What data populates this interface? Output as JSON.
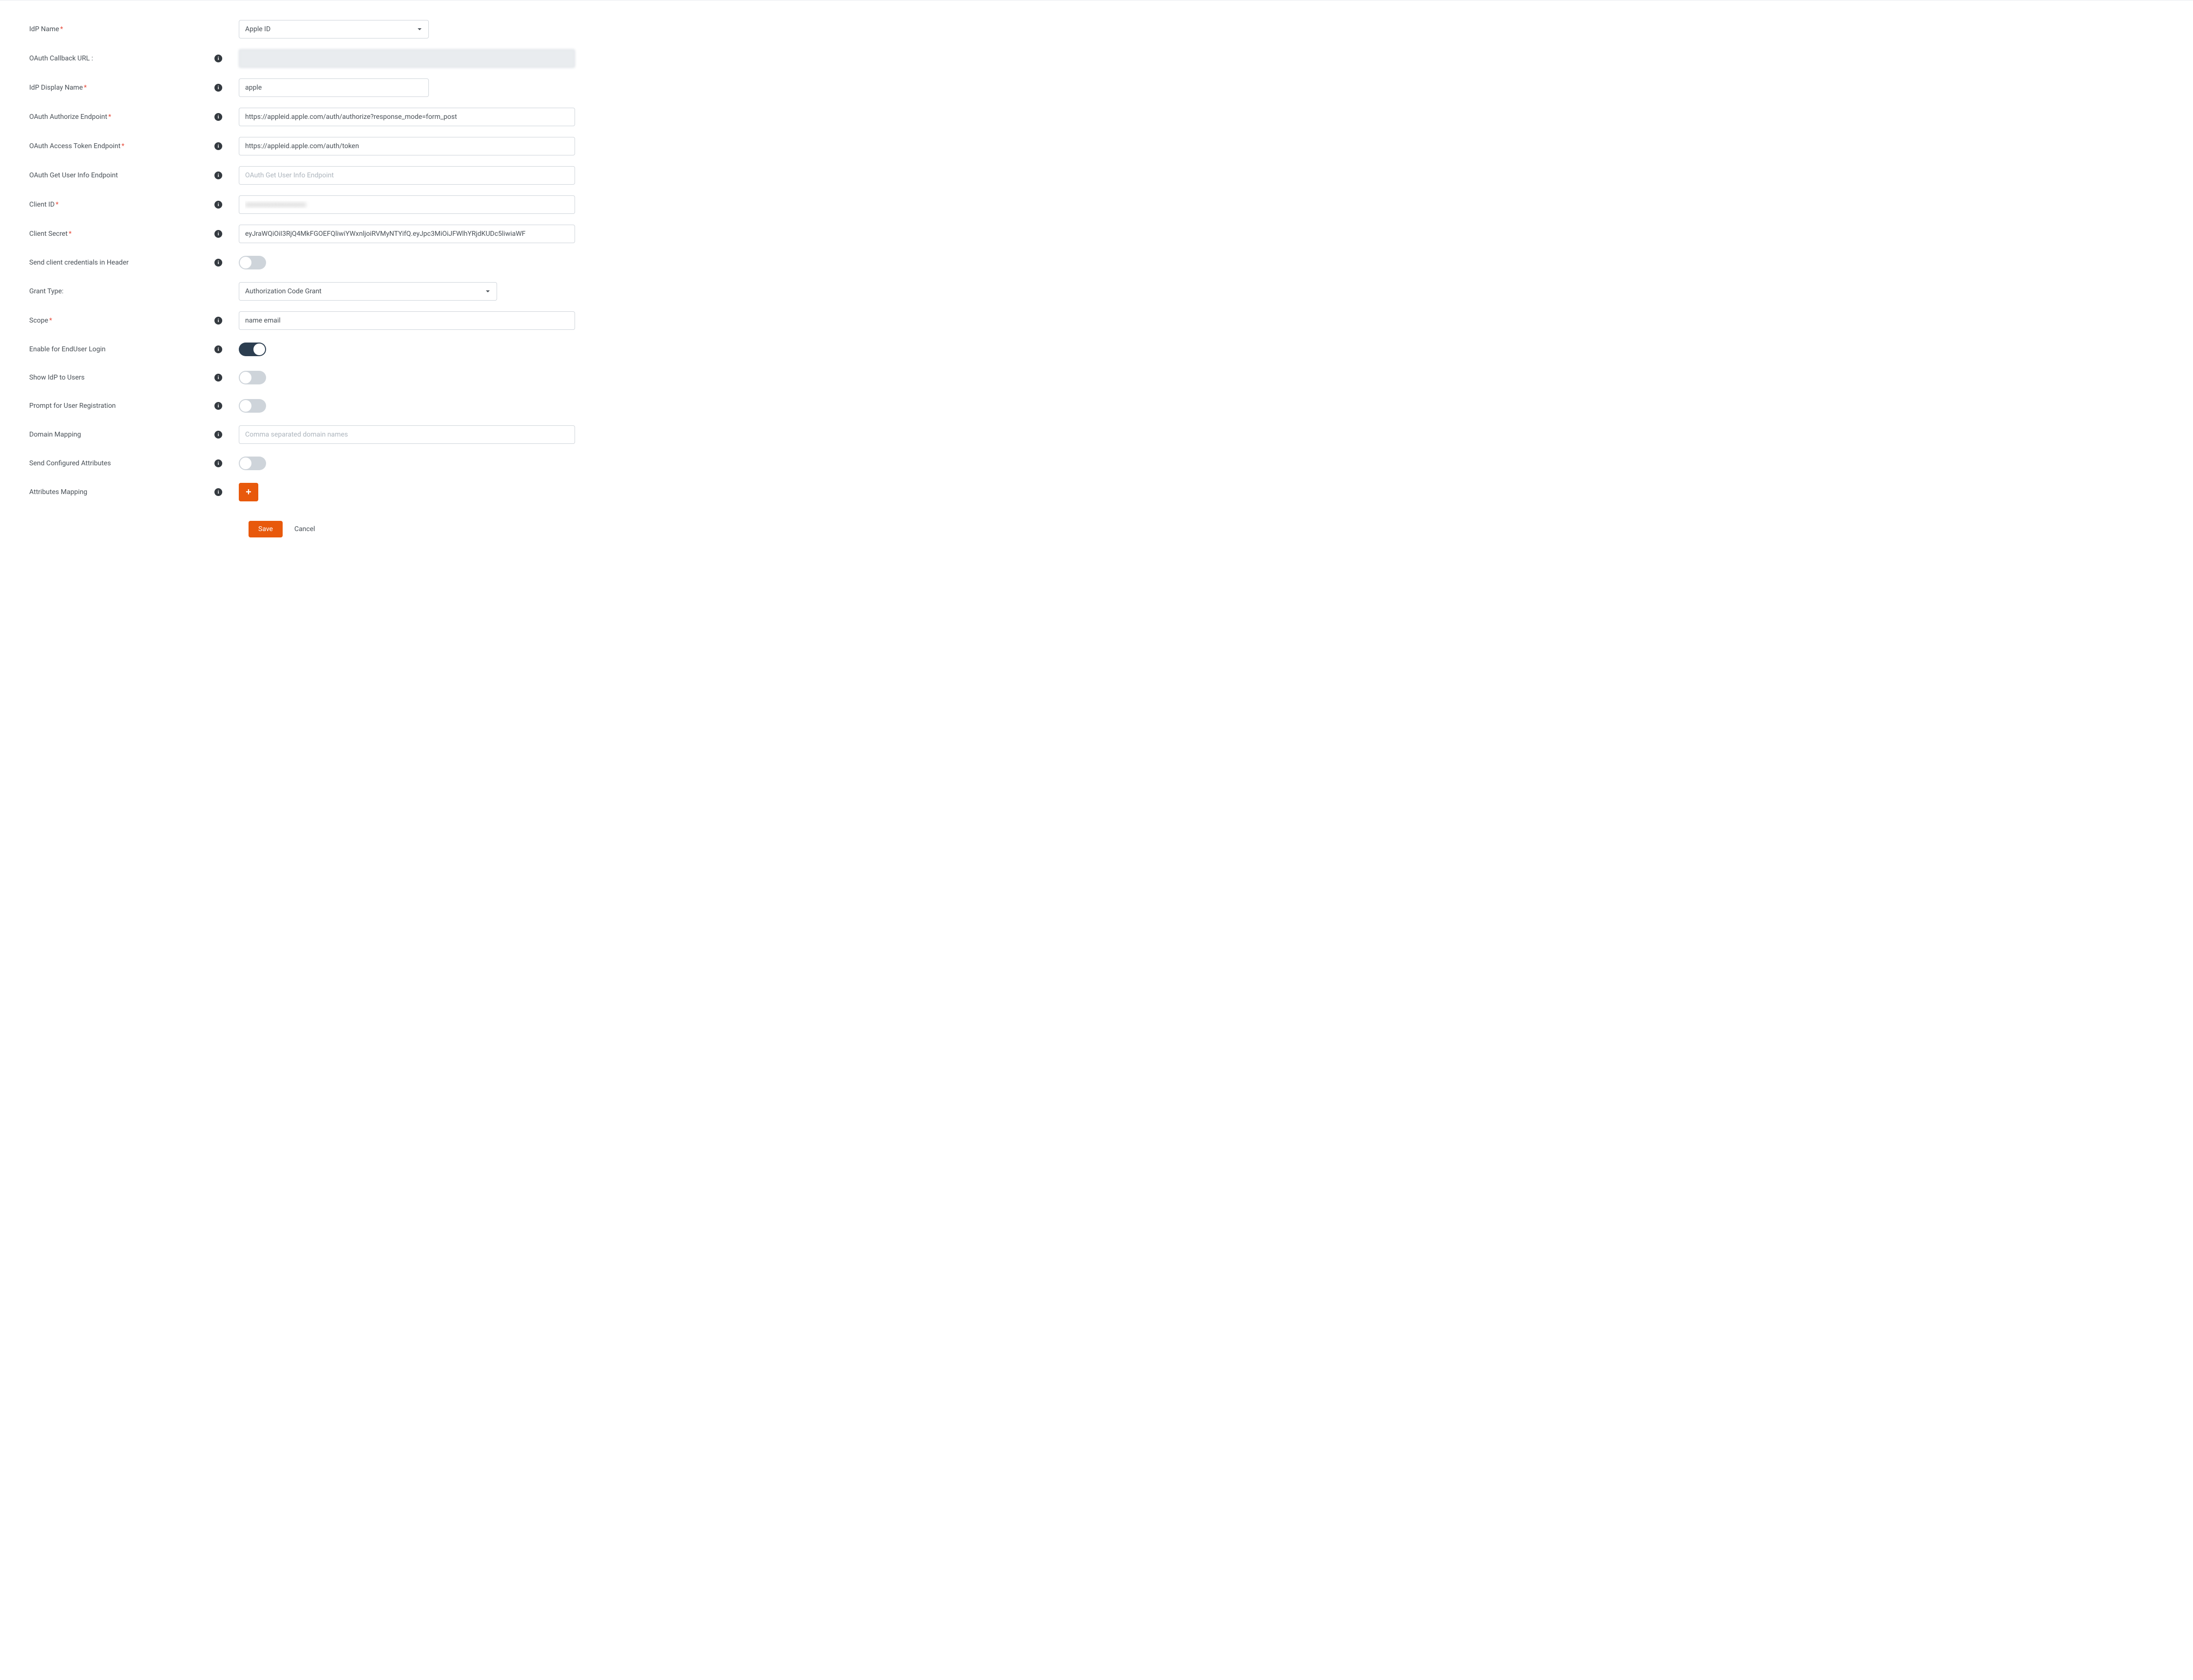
{
  "labels": {
    "idp_name": "IdP Name",
    "oauth_callback": "OAuth Callback URL :",
    "idp_display_name": "IdP Display Name",
    "oauth_authorize": "OAuth Authorize Endpoint",
    "oauth_token": "OAuth Access Token Endpoint",
    "oauth_userinfo": "OAuth Get User Info Endpoint",
    "client_id": "Client ID",
    "client_secret": "Client Secret",
    "send_header": "Send client credentials in Header",
    "grant_type": "Grant Type:",
    "scope": "Scope",
    "enable_enduser": "Enable for EndUser Login",
    "show_idp": "Show IdP to Users",
    "prompt_reg": "Prompt for User Registration",
    "domain_mapping": "Domain Mapping",
    "send_attrs": "Send Configured Attributes",
    "attrs_mapping": "Attributes Mapping"
  },
  "values": {
    "idp_name": "Apple ID",
    "callback_url": "",
    "display_name": "apple",
    "authorize_endpoint": "https://appleid.apple.com/auth/authorize?response_mode=form_post",
    "token_endpoint": "https://appleid.apple.com/auth/token",
    "userinfo_endpoint": "",
    "client_id": "",
    "client_secret": "eyJraWQiOiI3RjQ4MkFGOEFQliwiYWxnljoiRVMyNTYifQ.eyJpc3MiOiJFWlhYRjdKUDc5liwiaWF",
    "grant_type": "Authorization Code Grant",
    "scope": "name email",
    "domain_mapping": ""
  },
  "placeholders": {
    "userinfo": "OAuth Get User Info Endpoint",
    "domain_mapping": "Comma separated domain names"
  },
  "toggles": {
    "send_header": false,
    "enable_enduser": true,
    "show_idp": false,
    "prompt_reg": false,
    "send_attrs": false
  },
  "buttons": {
    "save": "Save",
    "cancel": "Cancel",
    "add": "+"
  },
  "icons": {
    "info": "i"
  }
}
